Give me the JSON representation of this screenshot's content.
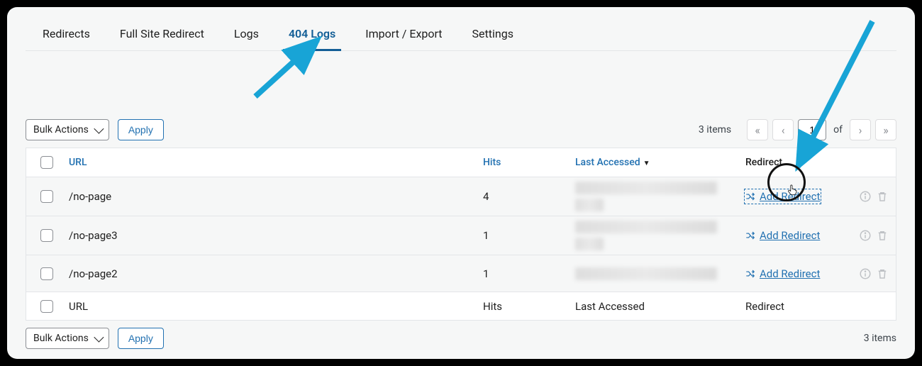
{
  "tabs": [
    {
      "label": "Redirects"
    },
    {
      "label": "Full Site Redirect"
    },
    {
      "label": "Logs"
    },
    {
      "label": "404 Logs"
    },
    {
      "label": "Import / Export"
    },
    {
      "label": "Settings"
    }
  ],
  "toolbar": {
    "bulk_label": "Bulk Actions",
    "apply_label": "Apply",
    "items_text": "3 items",
    "page_input": "1",
    "of_text": "of"
  },
  "columns": {
    "url": "URL",
    "hits": "Hits",
    "last": "Last Accessed",
    "redirect": "Redirect"
  },
  "rows": [
    {
      "url": "/no-page",
      "hits": "4",
      "add_label": "Add Redirect"
    },
    {
      "url": "/no-page3",
      "hits": "1",
      "add_label": "Add Redirect"
    },
    {
      "url": "/no-page2",
      "hits": "1",
      "add_label": "Add Redirect"
    }
  ],
  "footer": {
    "url": "URL",
    "hits": "Hits",
    "last": "Last Accessed",
    "redirect": "Redirect"
  }
}
